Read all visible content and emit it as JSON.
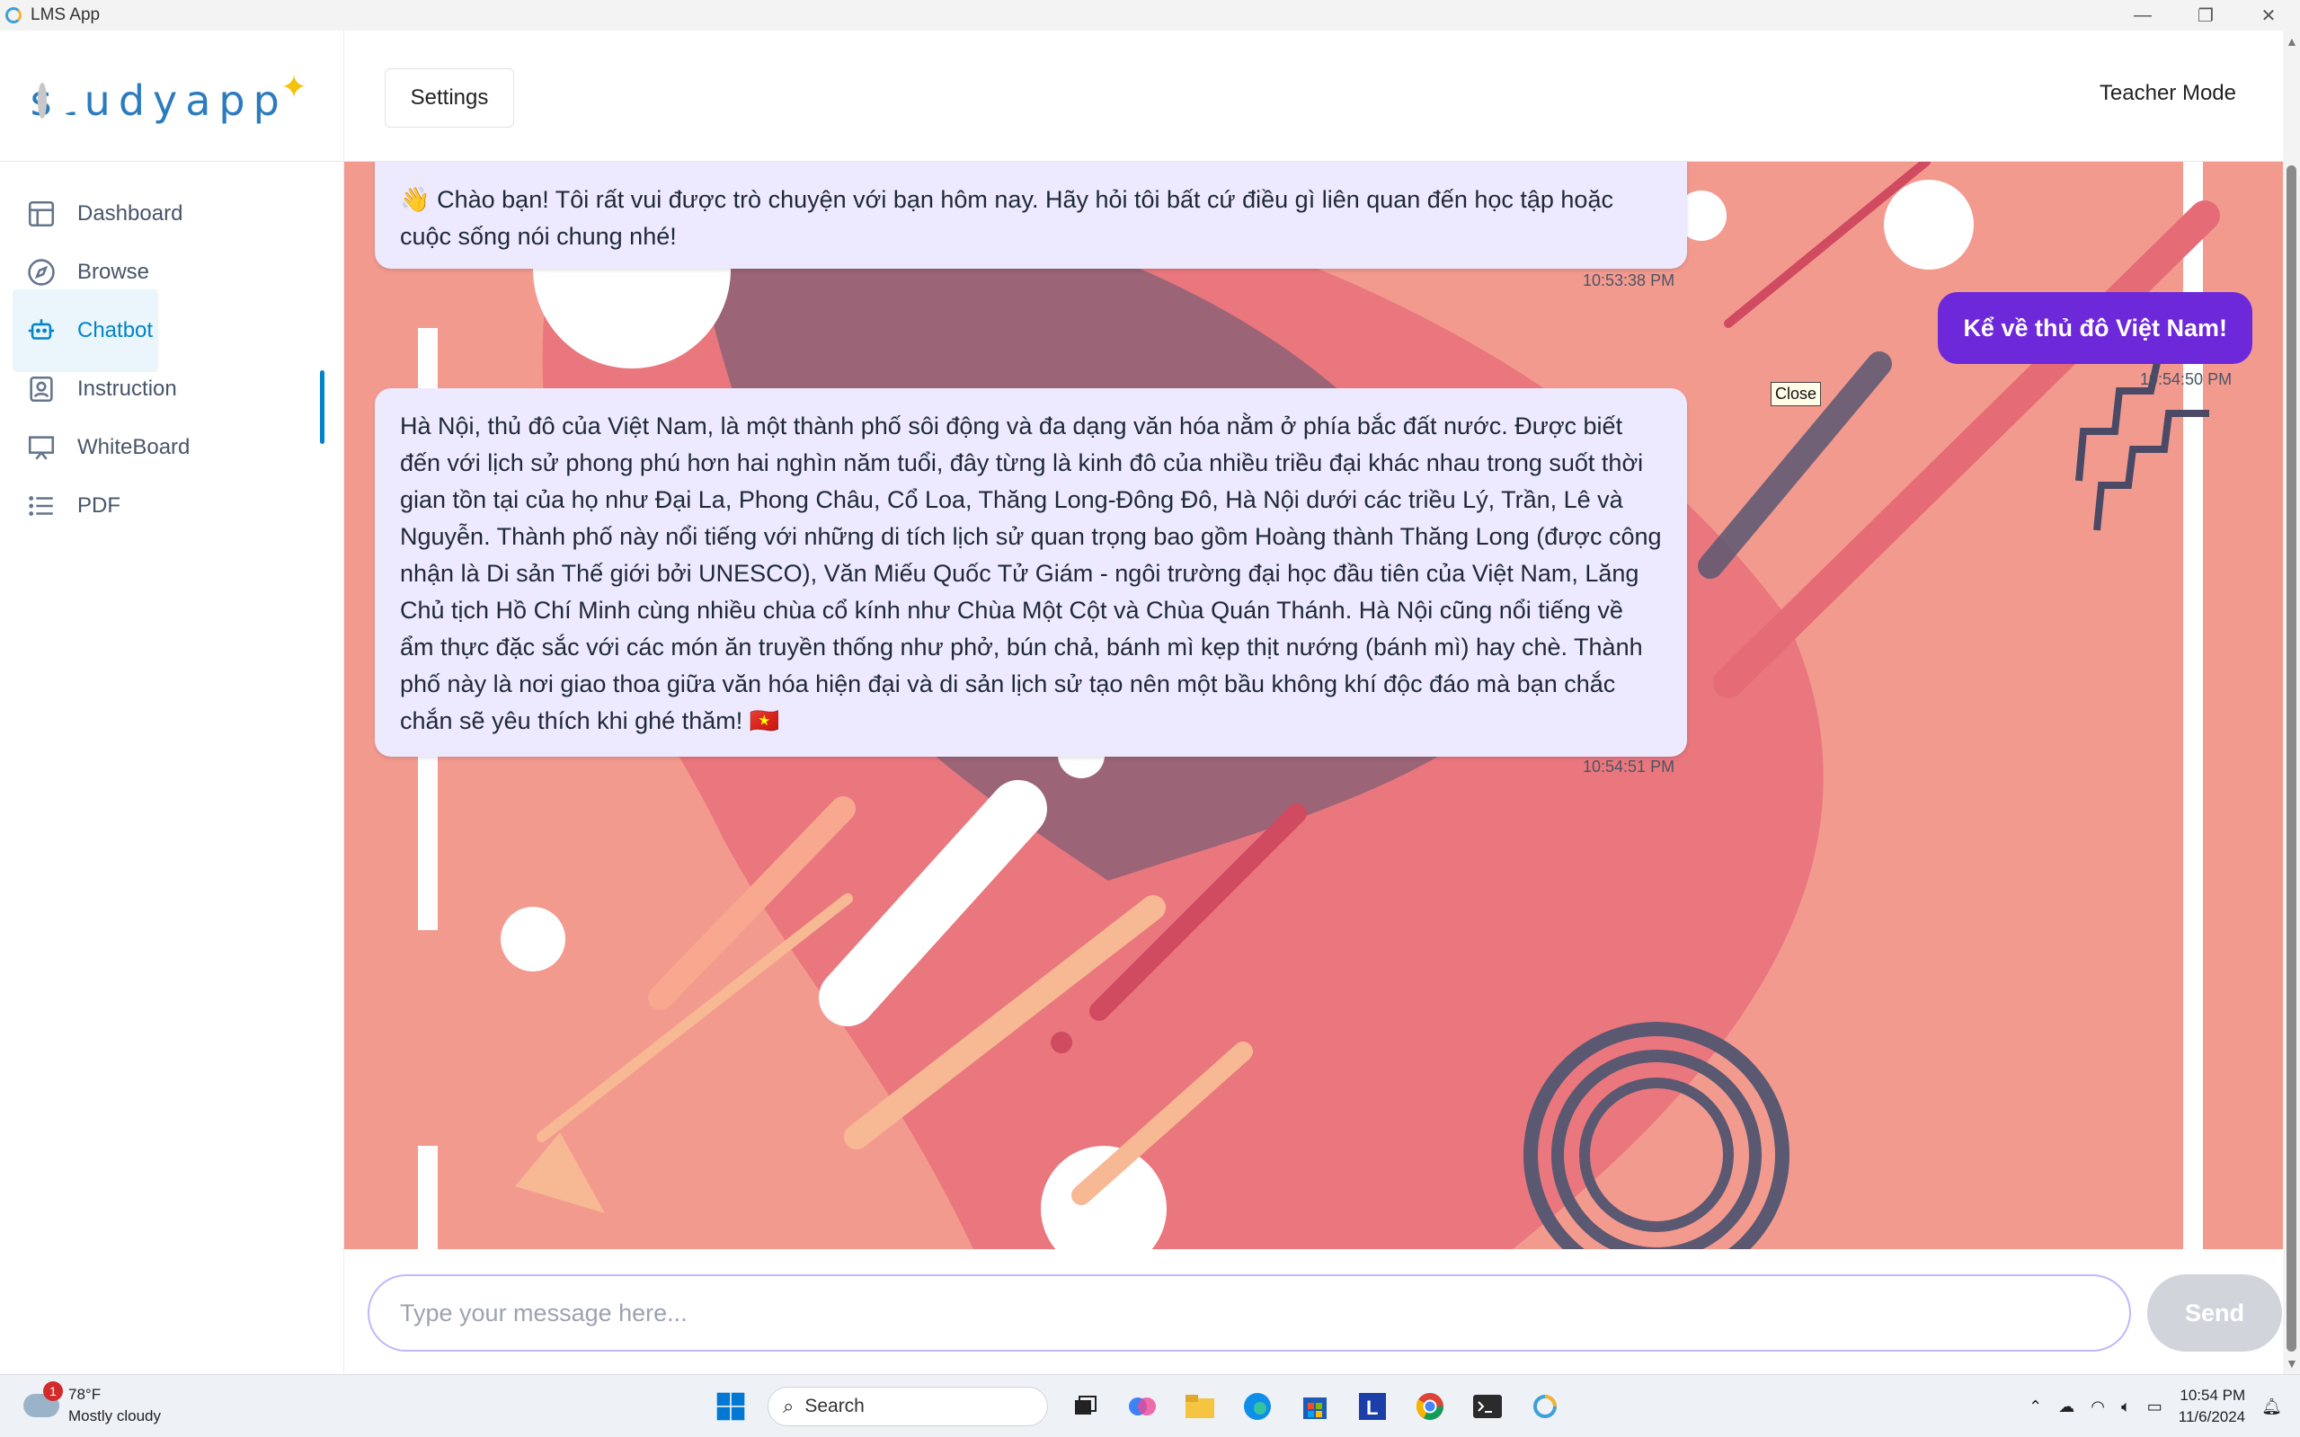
{
  "window": {
    "title": "LMS App"
  },
  "header": {
    "logo_text": "studyapp",
    "settings_label": "Settings",
    "mode_label": "Teacher Mode"
  },
  "sidebar": {
    "items": [
      {
        "label": "Dashboard",
        "icon": "dashboard-icon"
      },
      {
        "label": "Browse",
        "icon": "compass-icon"
      },
      {
        "label": "Chatbot",
        "icon": "bot-icon",
        "active": true
      },
      {
        "label": "Instruction",
        "icon": "contact-book-icon"
      },
      {
        "label": "WhiteBoard",
        "icon": "presentation-icon"
      },
      {
        "label": "PDF",
        "icon": "list-icon"
      }
    ]
  },
  "chat": {
    "messages": [
      {
        "role": "bot",
        "text": "👋 Chào bạn! Tôi rất vui được trò chuyện với bạn hôm nay. Hãy hỏi tôi bất cứ điều gì liên quan đến học tập hoặc cuộc sống nói chung nhé!",
        "time": "10:53:38 PM"
      },
      {
        "role": "user",
        "text": "Kể về thủ đô Việt Nam!",
        "time": "10:54:50 PM"
      },
      {
        "role": "bot",
        "text": "Hà Nội, thủ đô của Việt Nam, là một thành phố sôi động và đa dạng văn hóa nằm ở phía bắc đất nước. Được biết đến với lịch sử phong phú hơn hai nghìn năm tuổi, đây từng là kinh đô của nhiều triều đại khác nhau trong suốt thời gian tồn tại của họ như Đại La, Phong Châu, Cổ Loa, Thăng Long-Đông Đô, Hà Nội dưới các triều Lý, Trần, Lê và Nguyễn. Thành phố này nổi tiếng với những di tích lịch sử quan trọng bao gồm Hoàng thành Thăng Long (được công nhận là Di sản Thế giới bởi UNESCO), Văn Miếu Quốc Tử Giám - ngôi trường đại học đầu tiên của Việt Nam, Lăng Chủ tịch Hồ Chí Minh cùng nhiều chùa cổ kính như Chùa Một Cột và Chùa Quán Thánh. Hà Nội cũng nổi tiếng về ẩm thực đặc sắc với các món ăn truyền thống như phở, bún chả, bánh mì kẹp thịt nướng (bánh mì) hay chè. Thành phố này là nơi giao thoa giữa văn hóa hiện đại và di sản lịch sử tạo nên một bầu không khí độc đáo mà bạn chắc chắn sẽ yêu thích khi ghé thăm! 🇻🇳",
        "time": "10:54:51 PM"
      }
    ],
    "tooltip": "Close"
  },
  "input": {
    "placeholder": "Type your message here...",
    "value": "",
    "send_label": "Send"
  },
  "taskbar": {
    "weather_temp": "78°F",
    "weather_desc": "Mostly cloudy",
    "weather_badge": "1",
    "search_label": "Search",
    "time": "10:54 PM",
    "date": "11/6/2024"
  },
  "colors": {
    "accent": "#0284c7",
    "user_bubble": "#6d28d9",
    "bot_bubble": "#ede9fe",
    "toggle": "#facc15"
  }
}
